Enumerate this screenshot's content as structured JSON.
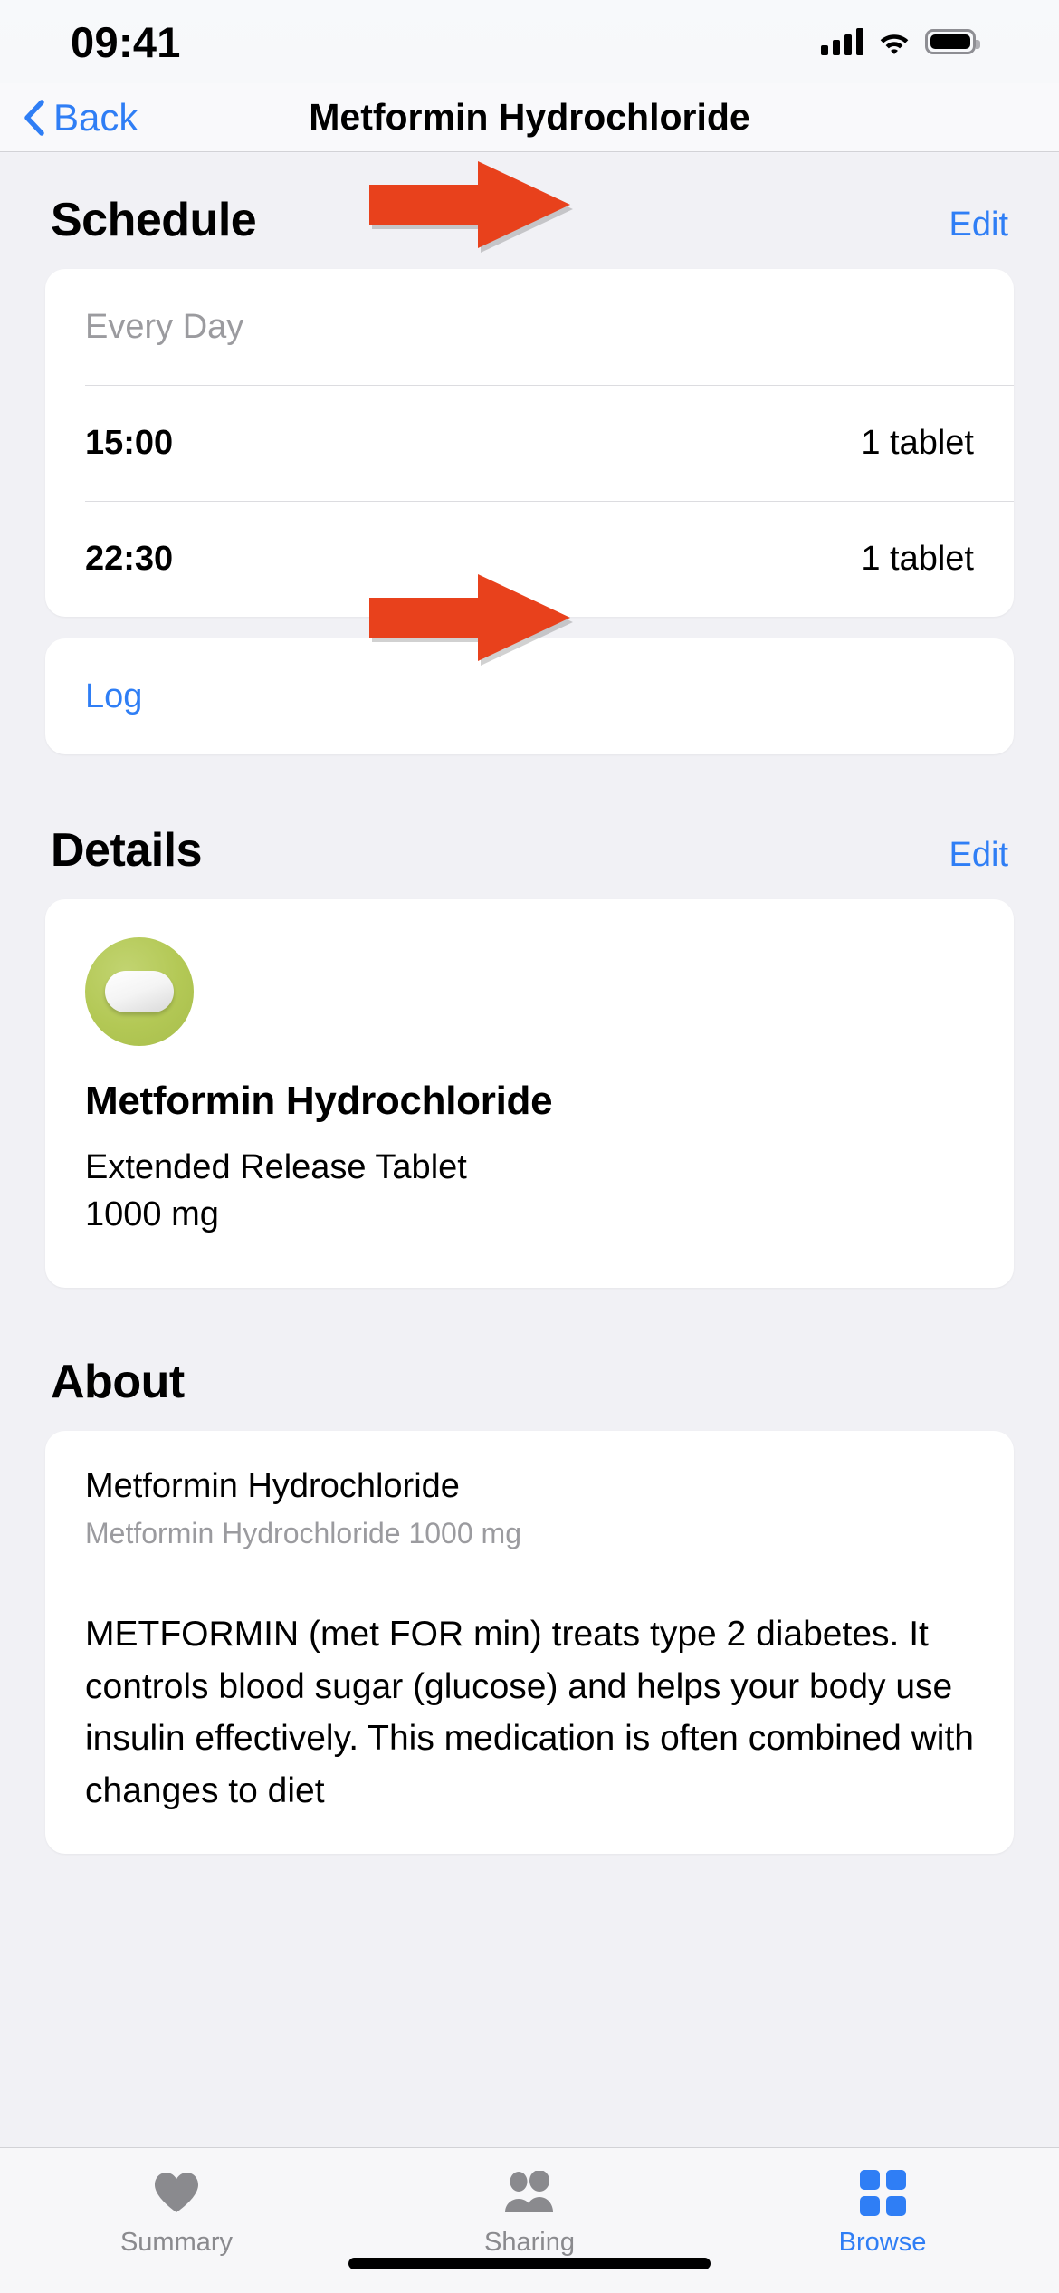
{
  "status_bar": {
    "time": "09:41",
    "icons": [
      "cellular-signal-icon",
      "wifi-icon",
      "battery-icon"
    ]
  },
  "nav_bar": {
    "back_label": "Back",
    "back_icon": "chevron-left-icon",
    "title": "Metformin Hydrochloride"
  },
  "schedule": {
    "title": "Schedule",
    "edit_label": "Edit",
    "frequency": "Every Day",
    "doses": [
      {
        "time": "15:00",
        "amount": "1 tablet"
      },
      {
        "time": "22:30",
        "amount": "1 tablet"
      }
    ],
    "log_label": "Log"
  },
  "details": {
    "title": "Details",
    "edit_label": "Edit",
    "icon": "pill-tablet-icon",
    "icon_color": "#b3c855",
    "name": "Metformin Hydrochloride",
    "form": "Extended Release Tablet",
    "strength": "1000 mg"
  },
  "about": {
    "title": "About",
    "name": "Metformin Hydrochloride",
    "subtitle": "Metformin Hydrochloride 1000 mg",
    "description": "METFORMIN (met FOR min) treats type 2 diabetes. It controls blood sugar (glucose) and helps your body use insulin effectively. This medication is often combined with changes to diet"
  },
  "tab_bar": {
    "tabs": [
      {
        "label": "Summary",
        "icon": "heart-icon",
        "active": false
      },
      {
        "label": "Sharing",
        "icon": "people-icon",
        "active": false
      },
      {
        "label": "Browse",
        "icon": "grid-squares-icon",
        "active": true
      }
    ]
  },
  "annotations": {
    "color": "#e8411c",
    "arrows": [
      {
        "name": "arrow-pointing-to-schedule-edit",
        "target": "Edit"
      },
      {
        "name": "arrow-pointing-to-details-edit",
        "target": "Edit"
      }
    ]
  },
  "theme": {
    "accent": "#2f7ef5",
    "background": "#f1f1f5",
    "card": "#ffffff"
  }
}
